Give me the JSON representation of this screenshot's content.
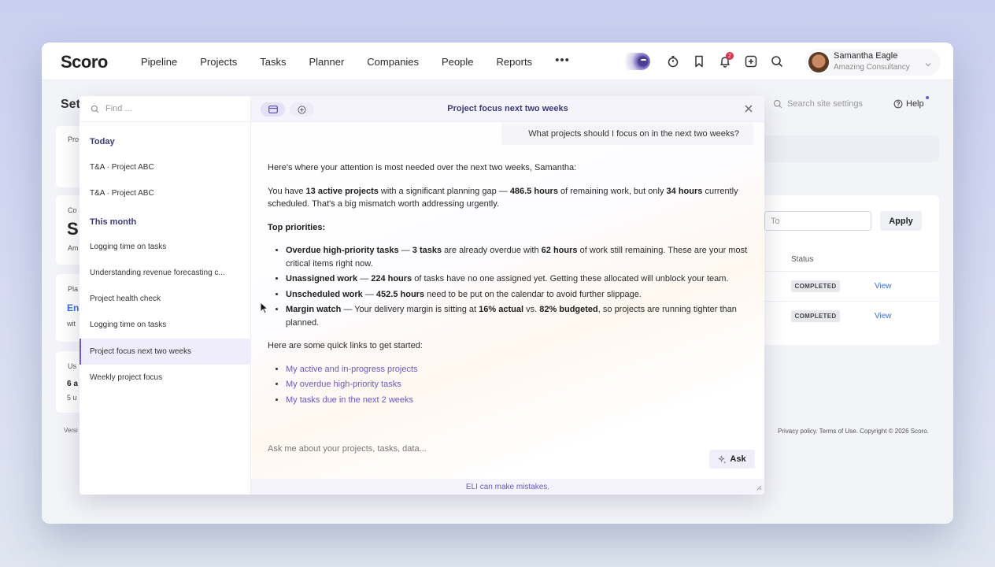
{
  "brand": {
    "logo_text": "Scoro"
  },
  "nav": {
    "items": [
      "Pipeline",
      "Projects",
      "Tasks",
      "Planner",
      "Companies",
      "People",
      "Reports"
    ],
    "more": "•••",
    "notification_count": "2"
  },
  "user": {
    "name": "Samantha Eagle",
    "org": "Amazing Consultancy"
  },
  "settings": {
    "title": "Set",
    "search_placeholder": "Search site settings",
    "help_label": "Help",
    "to_placeholder": "To",
    "apply_label": "Apply",
    "status_header": "Status",
    "rows": [
      {
        "status": "COMPLETED",
        "action": "View"
      },
      {
        "status": "COMPLETED",
        "action": "View"
      }
    ],
    "card_snippets": [
      "Pro",
      "Co",
      "S",
      "Am",
      "Pla",
      "En",
      "wit",
      "Us",
      "6 a",
      "5 u"
    ],
    "footer_left": "Versi",
    "footer_right": "Privacy policy. Terms of Use. Copyright © 2026 Scoro."
  },
  "eli": {
    "find_placeholder": "Find ...",
    "history": {
      "today_label": "Today",
      "today": [
        "T&A · Project ABC",
        "T&A · Project ABC"
      ],
      "month_label": "This month",
      "month": [
        "Logging time on tasks",
        "Understanding revenue forecasting c...",
        "Project health check",
        "Logging time on tasks",
        "Project focus next two weeks",
        "Weekly project focus"
      ]
    },
    "chat_title": "Project focus next two weeks",
    "user_question": "What projects should I focus on in the next two weeks?",
    "answer": {
      "intro": "Here's where your attention is most needed over the next two weeks, Samantha:",
      "summary": {
        "t1": "You have ",
        "b1": "13 active projects",
        "t2": " with a significant planning gap — ",
        "b2": "486.5 hours",
        "t3": " of remaining work, but only ",
        "b3": "34 hours",
        "t4": " currently scheduled. That's a big mismatch worth addressing urgently."
      },
      "priorities_heading": "Top priorities:",
      "priorities": [
        {
          "b": "Overdue high-priority tasks",
          "t1": " — ",
          "b2": "3 tasks",
          "t2": " are already overdue with ",
          "b3": "62 hours",
          "t3": " of work still remaining. These are your most critical items right now."
        },
        {
          "b": "Unassigned work",
          "t1": " — ",
          "b2": "224 hours",
          "t2": " of tasks have no one assigned yet. Getting these allocated will unblock your team."
        },
        {
          "b": "Unscheduled work",
          "t1": " — ",
          "b2": "452.5 hours",
          "t2": " need to be put on the calendar to avoid further slippage."
        },
        {
          "b": "Margin watch",
          "t1": " — Your delivery margin is sitting at ",
          "b2": "16% actual",
          "t2": " vs. ",
          "b3": "82% budgeted",
          "t3": ", so projects are running tighter than planned."
        }
      ],
      "links_intro": "Here are some quick links to get started:",
      "links": [
        "My active and in-progress projects",
        "My overdue high-priority tasks",
        "My tasks due in the next 2 weeks"
      ]
    },
    "ask_placeholder": "Ask me about your projects, tasks, data...",
    "ask_label": "Ask",
    "disclaimer": "ELI can make mistakes."
  },
  "colors": {
    "accent": "#6c5cc9",
    "title": "#3d3a7a",
    "badge": "#e0314b",
    "link": "#3a6fd8"
  }
}
